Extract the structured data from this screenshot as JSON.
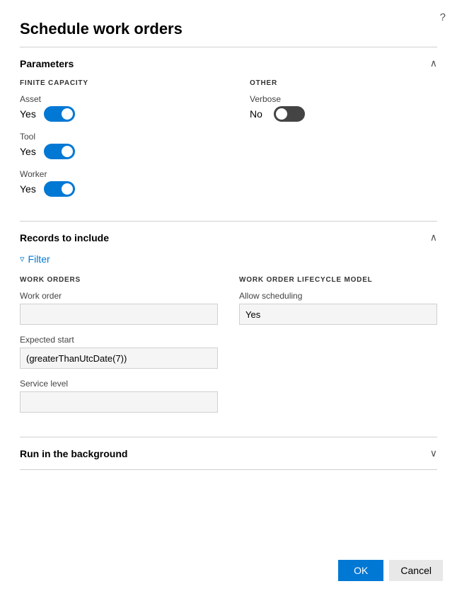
{
  "page": {
    "title": "Schedule work orders",
    "help_icon": "?"
  },
  "sections": {
    "parameters": {
      "title": "Parameters",
      "chevron": "^",
      "finite_capacity": {
        "label": "FINITE CAPACITY",
        "items": [
          {
            "id": "asset",
            "label": "Asset",
            "value": "Yes",
            "state": "on"
          },
          {
            "id": "tool",
            "label": "Tool",
            "value": "Yes",
            "state": "on"
          },
          {
            "id": "worker",
            "label": "Worker",
            "value": "Yes",
            "state": "on"
          }
        ]
      },
      "other": {
        "label": "OTHER",
        "items": [
          {
            "id": "verbose",
            "label": "Verbose",
            "value": "No",
            "state": "off"
          }
        ]
      }
    },
    "records": {
      "title": "Records to include",
      "chevron": "^",
      "filter_label": "Filter",
      "work_orders": {
        "label": "WORK ORDERS",
        "fields": [
          {
            "id": "work-order",
            "label": "Work order",
            "value": ""
          },
          {
            "id": "expected-start",
            "label": "Expected start",
            "value": "(greaterThanUtcDate(7))"
          },
          {
            "id": "service-level",
            "label": "Service level",
            "value": ""
          }
        ]
      },
      "lifecycle": {
        "label": "WORK ORDER LIFECYCLE MODEL",
        "fields": [
          {
            "id": "allow-scheduling",
            "label": "Allow scheduling",
            "value": "Yes"
          }
        ]
      }
    },
    "run_background": {
      "title": "Run in the background",
      "chevron": "v"
    }
  },
  "footer": {
    "ok_label": "OK",
    "cancel_label": "Cancel"
  }
}
